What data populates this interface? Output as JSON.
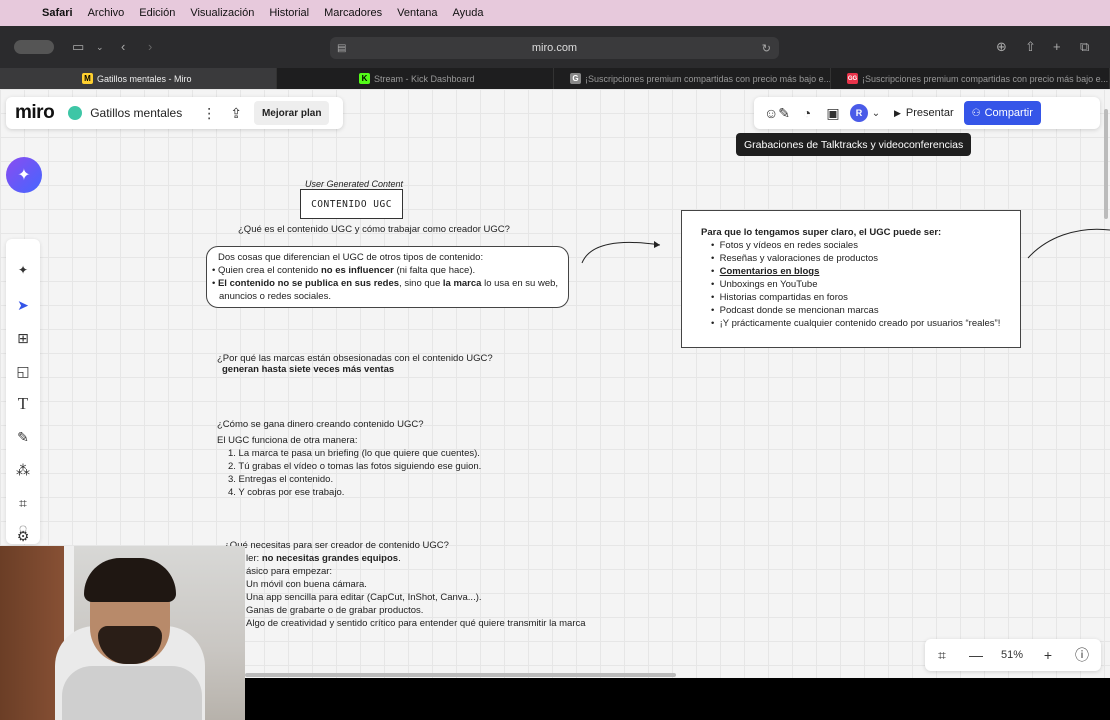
{
  "menubar": {
    "items": [
      "Safari",
      "Archivo",
      "Edición",
      "Visualización",
      "Historial",
      "Marcadores",
      "Ventana",
      "Ayuda"
    ]
  },
  "browser": {
    "url": "miro.com",
    "tabs": [
      {
        "title": "Gatillos mentales - Miro",
        "favicon": "M",
        "color": "#ffd02f",
        "active": true
      },
      {
        "title": "Stream - Kick Dashboard",
        "favicon": "K",
        "color": "#53fc18",
        "active": false
      },
      {
        "title": "¡Suscripciones premium compartidas con precio más bajo e...",
        "favicon": "G",
        "color": "#888888",
        "active": false
      },
      {
        "title": "¡Suscripciones premium compartidas con precio más bajo e...",
        "favicon": "GG",
        "color": "#e8334a",
        "active": false
      }
    ]
  },
  "miro": {
    "logo": "miro",
    "board_name": "Gatillos mentales",
    "upgrade_label": "Mejorar plan",
    "avatar_initial": "R",
    "present_label": "Presentar",
    "share_label": "Compartir",
    "tooltip": "Grabaciones de Talktracks y videoconferencias",
    "zoom": "51%"
  },
  "board": {
    "ugc_caption": "User Generated Content",
    "ugc_title": "CONTENIDO UGC",
    "q1": "¿Qué es el contenido UGC y cómo trabajar como creador UGC?",
    "box1": {
      "line1": "Dos cosas que diferencian el UGC de otros tipos de contenido:",
      "b1_pre": "Quien crea el contenido ",
      "b1_bold": "no es influencer",
      "b1_post": " (ni falta que hace).",
      "b2_bold": "El contenido no se publica en sus redes",
      "b2_mid": ", sino que ",
      "b2_bold2": "la marca",
      "b2_post": " lo usa en su web,",
      "b2_cont": "anuncios o redes sociales."
    },
    "right_box": {
      "title": "Para que lo tengamos super claro, el UGC puede ser:",
      "items": [
        "Fotos y vídeos en redes sociales",
        "Reseñas y valoraciones de productos",
        "Comentarios en blogs",
        "Unboxings en YouTube",
        "Historias compartidas en foros",
        "Podcast donde se mencionan marcas",
        "¡Y prácticamente cualquier contenido creado por usuarios “reales”!"
      ]
    },
    "q2": "¿Por qué las marcas están obsesionadas con el contenido UGC?",
    "a2": "generan hasta siete veces más ventas",
    "q3": "¿Cómo se gana dinero creando contenido UGC?",
    "a3_intro": "El UGC funciona de otra manera:",
    "a3_steps": [
      "1. La marca te pasa un briefing (lo que quiere que cuentes).",
      "2. Tú grabas el vídeo o tomas las fotos siguiendo ese guion.",
      "3. Entregas el contenido.",
      "4. Y cobras por ese trabajo."
    ],
    "q4": "¿Qué necesitas para ser creador de contenido UGC?",
    "a4_pre": "ler: ",
    "a4_bold": "no necesitas grandes equipos",
    "a4_post": ".",
    "a4_basic": "ásico para empezar:",
    "a4_items": [
      "Un móvil con buena cámara.",
      "Una app sencilla para editar (CapCut, InShot, Canva...).",
      "Ganas de grabarte o de grabar productos.",
      "Algo de creatividad y sentido crítico para entender qué quiere transmitir la marca"
    ]
  }
}
